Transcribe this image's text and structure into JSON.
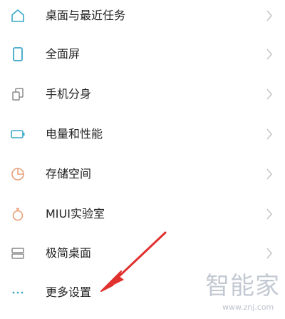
{
  "settings": {
    "items": [
      {
        "label": "桌面与最近任务",
        "icon": "home-icon",
        "has_chevron": true
      },
      {
        "label": "全面屏",
        "icon": "phone-icon",
        "has_chevron": true
      },
      {
        "label": "手机分身",
        "icon": "dual-copy-icon",
        "has_chevron": true
      },
      {
        "label": "电量和性能",
        "icon": "battery-icon",
        "has_chevron": true
      },
      {
        "label": "存储空间",
        "icon": "storage-pie-icon",
        "has_chevron": true
      },
      {
        "label": "MIUI实验室",
        "icon": "flask-icon",
        "has_chevron": true
      },
      {
        "label": "极简桌面",
        "icon": "simple-desktop-icon",
        "has_chevron": true
      },
      {
        "label": "更多设置",
        "icon": "more-dots-icon",
        "has_chevron": false
      }
    ]
  },
  "annotation": {
    "arrow_color": "#e0312f"
  },
  "watermark": {
    "text": "智能家",
    "url": "www.znj.com"
  },
  "colors": {
    "icon_blue": "#3aa8c8",
    "icon_orange": "#e8a07a",
    "text": "#222222",
    "chevron": "#c4c4c4"
  }
}
